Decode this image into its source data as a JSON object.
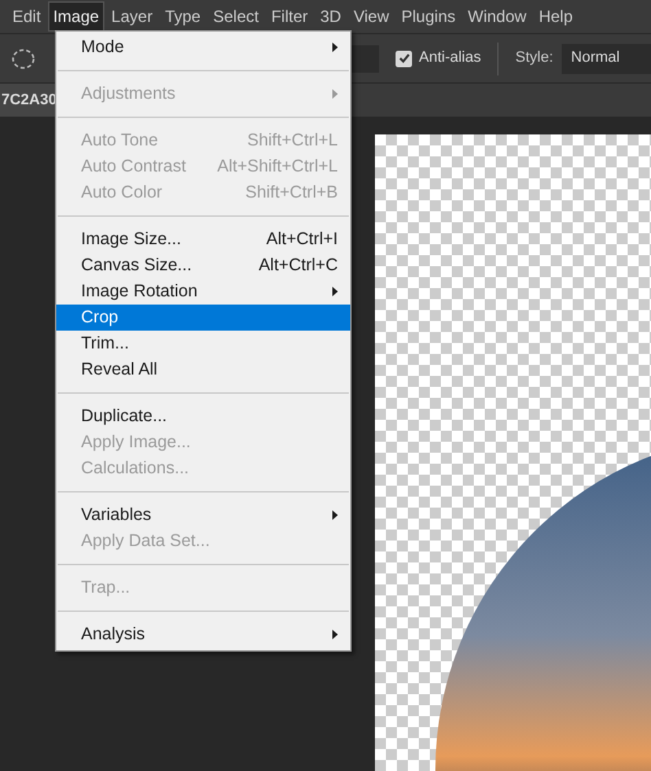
{
  "menubar": [
    {
      "label": "Edit",
      "selected": false
    },
    {
      "label": "Image",
      "selected": true
    },
    {
      "label": "Layer",
      "selected": false
    },
    {
      "label": "Type",
      "selected": false
    },
    {
      "label": "Select",
      "selected": false
    },
    {
      "label": "Filter",
      "selected": false
    },
    {
      "label": "3D",
      "selected": false
    },
    {
      "label": "View",
      "selected": false
    },
    {
      "label": "Plugins",
      "selected": false
    },
    {
      "label": "Window",
      "selected": false
    },
    {
      "label": "Help",
      "selected": false
    }
  ],
  "options_bar": {
    "anti_alias": {
      "label": "Anti-alias",
      "checked": true
    },
    "style": {
      "label": "Style:",
      "value": "Normal"
    }
  },
  "document_tab": {
    "title": "7C2A30"
  },
  "menu": [
    {
      "kind": "item",
      "label": "Mode",
      "disabled": false,
      "selected": false,
      "submenu": true
    },
    {
      "kind": "separator"
    },
    {
      "kind": "item",
      "label": "Adjustments",
      "disabled": true,
      "selected": false,
      "submenu": true
    },
    {
      "kind": "separator"
    },
    {
      "kind": "item",
      "label": "Auto Tone",
      "shortcut": "Shift+Ctrl+L",
      "disabled": true,
      "selected": false,
      "submenu": false
    },
    {
      "kind": "item",
      "label": "Auto Contrast",
      "shortcut": "Alt+Shift+Ctrl+L",
      "disabled": true,
      "selected": false,
      "submenu": false
    },
    {
      "kind": "item",
      "label": "Auto Color",
      "shortcut": "Shift+Ctrl+B",
      "disabled": true,
      "selected": false,
      "submenu": false
    },
    {
      "kind": "separator"
    },
    {
      "kind": "item",
      "label": "Image Size...",
      "shortcut": "Alt+Ctrl+I",
      "disabled": false,
      "selected": false,
      "submenu": false
    },
    {
      "kind": "item",
      "label": "Canvas Size...",
      "shortcut": "Alt+Ctrl+C",
      "disabled": false,
      "selected": false,
      "submenu": false
    },
    {
      "kind": "item",
      "label": "Image Rotation",
      "disabled": false,
      "selected": false,
      "submenu": true
    },
    {
      "kind": "item",
      "label": "Crop",
      "disabled": false,
      "selected": true,
      "submenu": false
    },
    {
      "kind": "item",
      "label": "Trim...",
      "disabled": false,
      "selected": false,
      "submenu": false
    },
    {
      "kind": "item",
      "label": "Reveal All",
      "disabled": false,
      "selected": false,
      "submenu": false
    },
    {
      "kind": "separator"
    },
    {
      "kind": "item",
      "label": "Duplicate...",
      "disabled": false,
      "selected": false,
      "submenu": false
    },
    {
      "kind": "item",
      "label": "Apply Image...",
      "disabled": true,
      "selected": false,
      "submenu": false
    },
    {
      "kind": "item",
      "label": "Calculations...",
      "disabled": true,
      "selected": false,
      "submenu": false
    },
    {
      "kind": "separator"
    },
    {
      "kind": "item",
      "label": "Variables",
      "disabled": false,
      "selected": false,
      "submenu": true
    },
    {
      "kind": "item",
      "label": "Apply Data Set...",
      "disabled": true,
      "selected": false,
      "submenu": false
    },
    {
      "kind": "separator"
    },
    {
      "kind": "item",
      "label": "Trap...",
      "disabled": true,
      "selected": false,
      "submenu": false
    },
    {
      "kind": "separator"
    },
    {
      "kind": "item",
      "label": "Analysis",
      "disabled": false,
      "selected": false,
      "submenu": true
    }
  ]
}
